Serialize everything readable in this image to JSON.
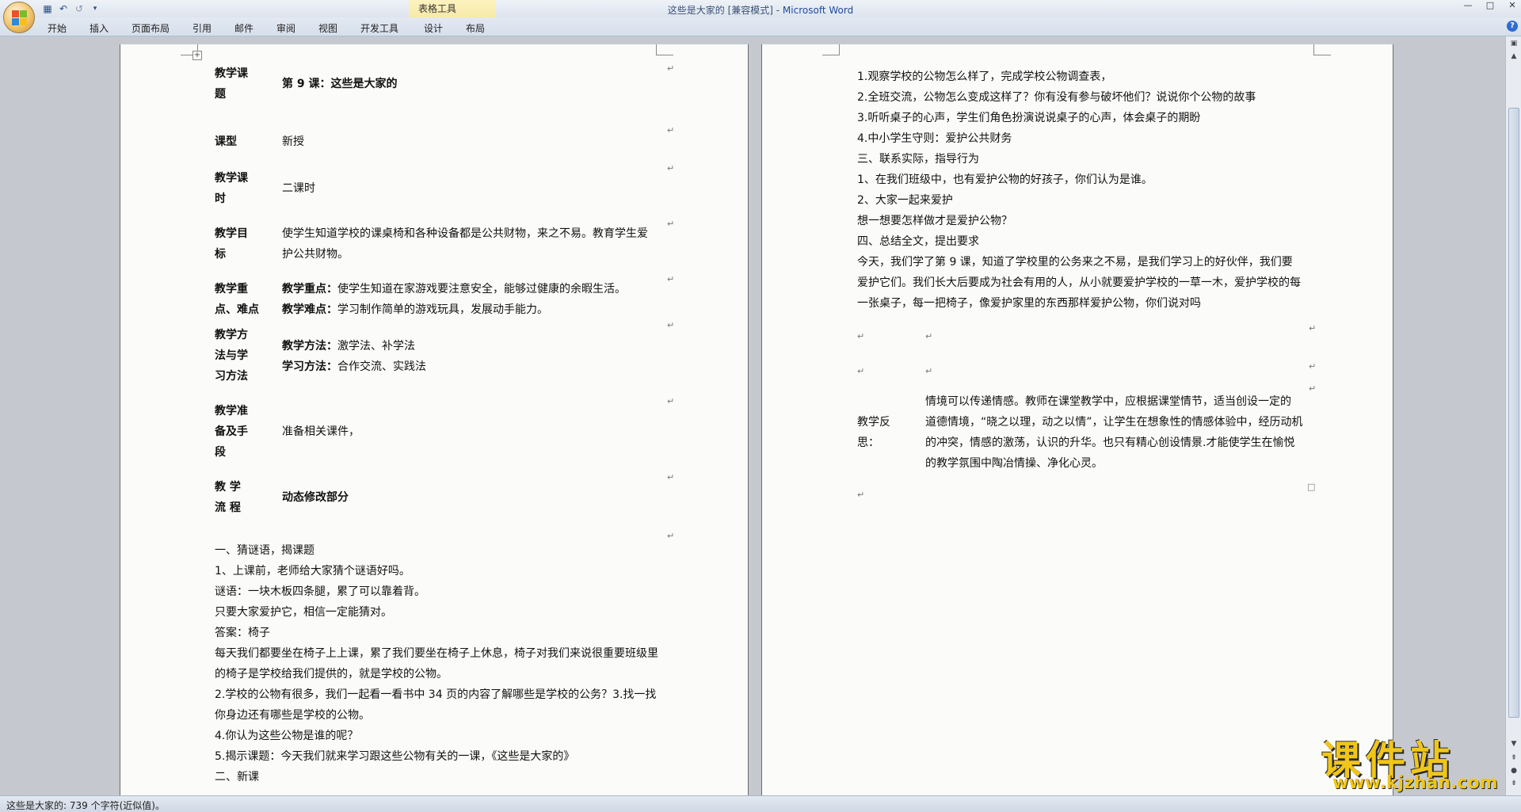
{
  "window": {
    "title_doc": "这些是大家的 [兼容模式] - ",
    "title_app": "Microsoft Word",
    "context_group": "表格工具"
  },
  "ribbon": {
    "tabs": [
      "开始",
      "插入",
      "页面布局",
      "引用",
      "邮件",
      "审阅",
      "视图",
      "开发工具",
      "设计",
      "布局"
    ]
  },
  "icons": {
    "office_button": "office-logo-icon",
    "save": "save-icon",
    "undo": "undo-icon",
    "redo": "redo-icon",
    "qat_more": "qat-dropdown-icon",
    "help": "help-icon",
    "minimize": "minimize-icon",
    "restore": "restore-icon",
    "close": "close-icon"
  },
  "colors": {
    "accent": "#1f4a9c",
    "watermark": "#f0c619",
    "context_tab": "#f6e7a2"
  },
  "lesson_table": {
    "rows": [
      {
        "label": [
          "教学课",
          "题"
        ],
        "content": [
          "第 9 课：这些是大家的"
        ],
        "bold_content": true
      },
      {
        "label": [
          "课型"
        ],
        "content": [
          "新授"
        ]
      },
      {
        "label": [
          "教学课",
          "时"
        ],
        "content": [
          "二课时"
        ]
      },
      {
        "label": [
          "教学目",
          "标"
        ],
        "content": [
          "使学生知道学校的课桌椅和各种设备都是公共财物，来之不易。教育学生爱",
          "护公共财物。"
        ]
      },
      {
        "label": [
          "教学重",
          "点、难点"
        ],
        "content_parts": [
          {
            "b": "教学重点：",
            "t": "使学生知道在家游戏要注意安全，能够过健康的余暇生活。"
          },
          {
            "b": "教学难点：",
            "t": "学习制作简单的游戏玩具，发展动手能力。"
          }
        ]
      },
      {
        "label": [
          "教学方",
          "法与学",
          "习方法"
        ],
        "content_parts": [
          {
            "b": "教学方法：",
            "t": "激学法、补学法"
          },
          {
            "b": "学习方法：",
            "t": "合作交流、实践法"
          }
        ]
      },
      {
        "label": [
          "教学准",
          "备及手",
          "段"
        ],
        "content": [
          "准备相关课件，"
        ]
      },
      {
        "label": [
          "教 学",
          "流 程"
        ],
        "content": [
          "动态修改部分"
        ],
        "bold_content": true
      }
    ]
  },
  "left_body": [
    "一、猜谜语，揭课题",
    "1、上课前，老师给大家猜个谜语好吗。",
    "谜语：一块木板四条腿，累了可以靠着背。",
    "只要大家爱护它，相信一定能猜对。",
    "答案：椅子",
    "每天我们都要坐在椅子上上课，累了我们要坐在椅子上休息，椅子对我们来说很重要班级里",
    "的椅子是学校给我们提供的，就是学校的公物。",
    "2.学校的公物有很多，我们一起看一看书中 34 页的内容了解哪些是学校的公务？3.找一找",
    "你身边还有哪些是学校的公物。",
    "4.你认为这些公物是谁的呢？",
    "5.揭示课题：今天我们就来学习跟这些公物有关的一课，《这些是大家的》",
    "二、新课"
  ],
  "right_body": [
    "1.观察学校的公物怎么样了，完成学校公物调查表，",
    "2.全班交流，公物怎么变成这样了？你有没有参与破坏他们？说说你个公物的故事",
    "3.听听桌子的心声，学生们角色扮演说说桌子的心声，体会桌子的期盼",
    "4.中小学生守则：爱护公共财务",
    "三、联系实际，指导行为",
    "1、在我们班级中，也有爱护公物的好孩子，你们认为是谁。",
    "2、大家一起来爱护",
    "想一想要怎样做才是爱护公物？",
    "四、总结全文，提出要求",
    "今天，我们学了第 9 课，知道了学校里的公务来之不易，是我们学习上的好伙伴，我们要",
    "爱护它们。我们长大后要成为社会有用的人，从小就要爱护学校的一草一木，爱护学校的每",
    "一张桌子，每一把椅子，像爱护家里的东西那样爱护公物，你们说对吗"
  ],
  "reflection": {
    "label": [
      "教学反",
      "思："
    ],
    "lines": [
      "情境可以传递情感。教师在课堂教学中，应根据课堂情节，适当创设一定的",
      "道德情境，“晓之以理，动之以情”，让学生在想象性的情感体验中，经历动机",
      "的冲突，情感的激荡，认识的升华。也只有精心创设情景.才能使学生在愉悦",
      "的教学氛围中陶冶情操、净化心灵。"
    ]
  },
  "status": {
    "text": "这些是大家的: 739 个字符(近似值)。"
  },
  "watermark": {
    "cn": "课件站",
    "url": "www.kjzhan.com"
  }
}
